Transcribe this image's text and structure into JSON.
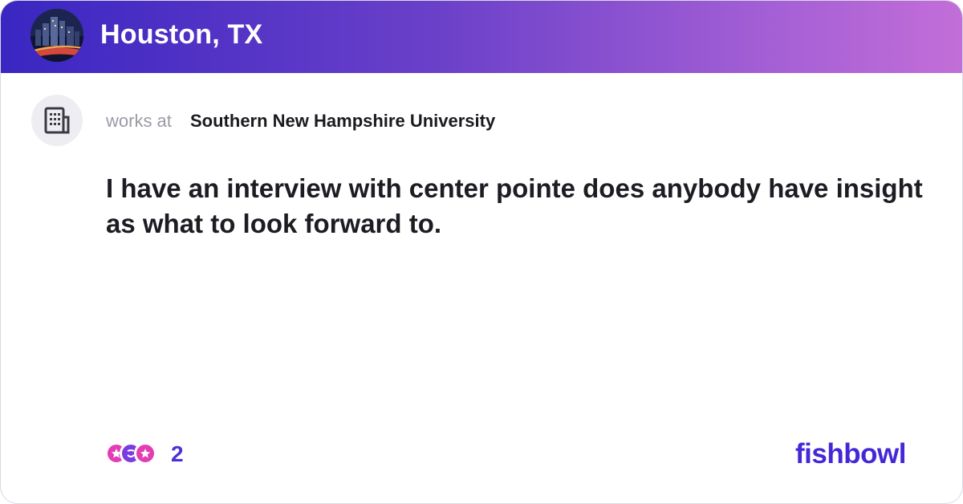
{
  "header": {
    "bowl_name": "Houston, TX",
    "avatar_icon": "city-skyline-photo",
    "gradient_start": "#3a26c2",
    "gradient_end": "#c26ed8"
  },
  "author": {
    "avatar_icon": "building-icon",
    "works_at_label": "works at",
    "company": "Southern New Hampshire University"
  },
  "post": {
    "text": "I have an interview with center pointe does anybody have insight as what to look forward to."
  },
  "footer": {
    "reaction_icons": [
      "star-face-icon",
      "wink-face-icon",
      "star-face-icon"
    ],
    "reaction_count": "2",
    "brand": "fishbowl",
    "brand_color": "#4428d8"
  }
}
